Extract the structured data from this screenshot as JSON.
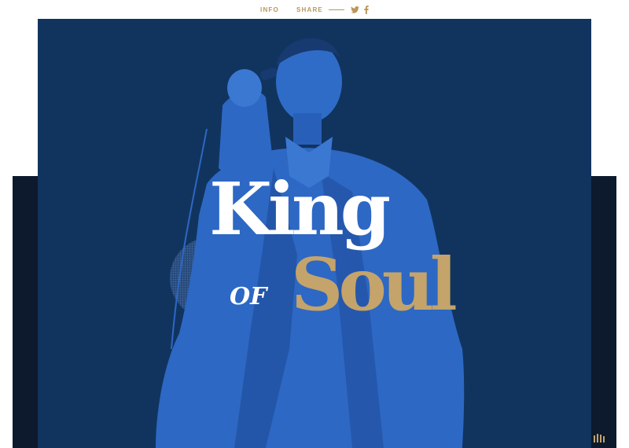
{
  "nav": {
    "info_label": "INFO",
    "share_label": "SHARE",
    "twitter_icon": "twitter-icon",
    "facebook_icon": "facebook-icon"
  },
  "hero": {
    "title_line1": "King",
    "title_of": "OF",
    "title_line2": "Soul"
  },
  "colors": {
    "accent_gold": "#c4a46a",
    "hero_blue": "#11345f",
    "figure_blue": "#2d68c4",
    "dark_band": "#0d1a2d"
  },
  "corner": {
    "icon": "menu-bars-icon"
  }
}
